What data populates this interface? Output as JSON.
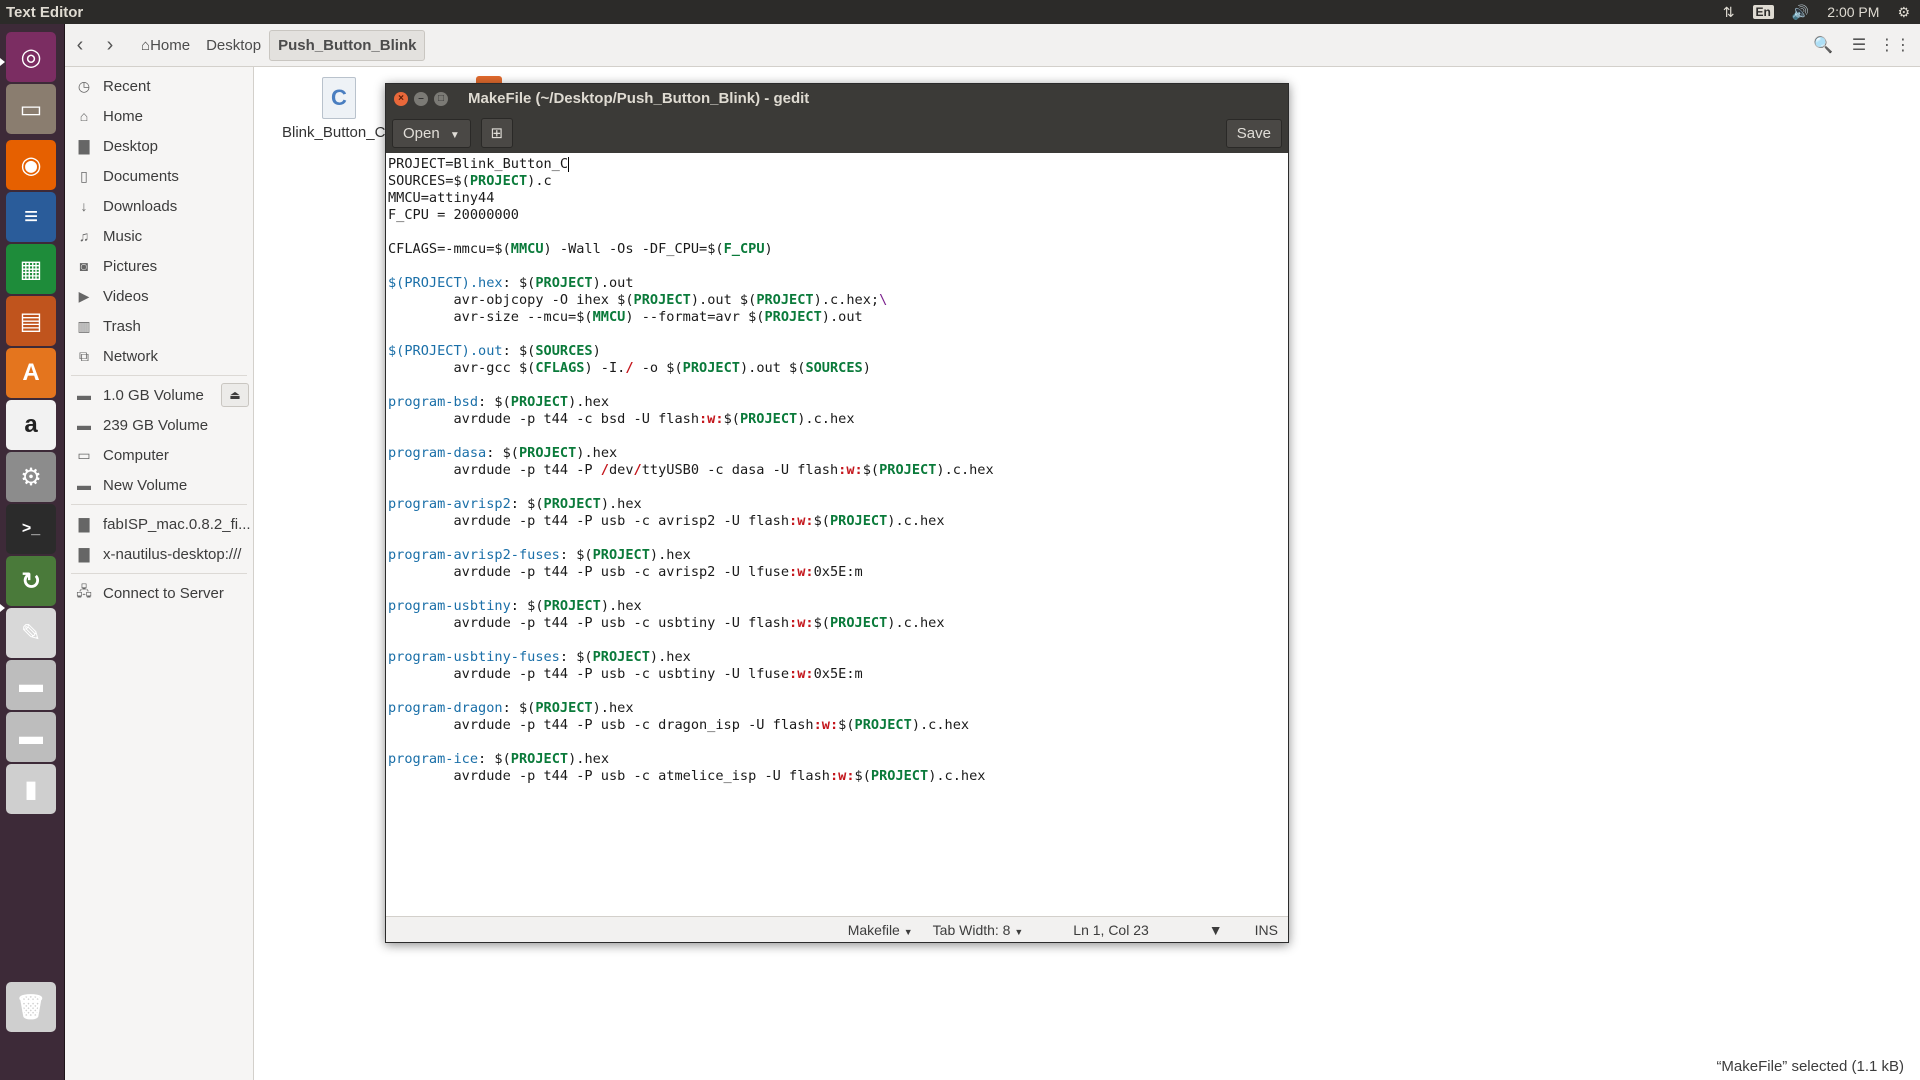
{
  "topbar": {
    "app_title": "Text Editor",
    "language": "En",
    "time": "2:00 PM"
  },
  "launcher": {
    "items": [
      {
        "icon": "ubuntu-dash-icon",
        "color": "#7b2d62"
      },
      {
        "icon": "files-icon",
        "color": "#8a7d6f"
      },
      {
        "icon": "firefox-icon",
        "color": "#e66000"
      },
      {
        "icon": "writer-icon",
        "color": "#2a5c9a"
      },
      {
        "icon": "calc-icon",
        "color": "#1e8c3a"
      },
      {
        "icon": "impress-icon",
        "color": "#c0541d"
      },
      {
        "icon": "software-center-icon",
        "color": "#e4751e"
      },
      {
        "icon": "amazon-icon",
        "color": "#f2f2f2"
      },
      {
        "icon": "system-settings-icon",
        "color": "#8c8c8c"
      },
      {
        "icon": "terminal-icon",
        "color": "#2b2b2b"
      },
      {
        "icon": "software-updater-icon",
        "color": "#4a7a3a"
      },
      {
        "icon": "gedit-icon",
        "color": "#d8d8d8"
      },
      {
        "icon": "drive-icon",
        "color": "#bdbdbd"
      },
      {
        "icon": "drive-2-icon",
        "color": "#bdbdbd"
      },
      {
        "icon": "usb-drive-icon",
        "color": "#cfcfcf"
      },
      {
        "icon": "trash-icon",
        "color": "#cfcfcf"
      }
    ]
  },
  "nautilus": {
    "breadcrumbs": [
      "Home",
      "Desktop",
      "Push_Button_Blink"
    ],
    "sidebar": {
      "places": [
        {
          "label": "Recent",
          "icon": "clock-icon"
        },
        {
          "label": "Home",
          "icon": "home-icon"
        },
        {
          "label": "Desktop",
          "icon": "folder-icon"
        },
        {
          "label": "Documents",
          "icon": "document-icon"
        },
        {
          "label": "Downloads",
          "icon": "download-icon"
        },
        {
          "label": "Music",
          "icon": "music-icon"
        },
        {
          "label": "Pictures",
          "icon": "camera-icon"
        },
        {
          "label": "Videos",
          "icon": "video-icon"
        },
        {
          "label": "Trash",
          "icon": "trash-icon"
        },
        {
          "label": "Network",
          "icon": "network-icon"
        }
      ],
      "devices": [
        {
          "label": "1.0 GB Volume",
          "icon": "drive-icon"
        },
        {
          "label": "239 GB Volume",
          "icon": "drive-icon"
        },
        {
          "label": "Computer",
          "icon": "computer-icon"
        },
        {
          "label": "New Volume",
          "icon": "drive-icon"
        }
      ],
      "bookmarks": [
        {
          "label": "fabISP_mac.0.8.2_fi...",
          "icon": "folder-icon"
        },
        {
          "label": "x-nautilus-desktop:///",
          "icon": "folder-icon"
        }
      ],
      "connect_label": "Connect to Server"
    },
    "files": [
      {
        "label": "Blink_Button_C"
      }
    ],
    "status": "“MakeFile” selected  (1.1 kB)"
  },
  "gedit": {
    "title": "MakeFile (~/Desktop/Push_Button_Blink) - gedit",
    "open_label": "Open",
    "save_label": "Save",
    "code_lines": [
      [
        [
          "t",
          "PROJECT=Blink_Button_C"
        ]
      ],
      [
        [
          "t",
          "SOURCES=$("
        ],
        [
          "k",
          "PROJECT"
        ],
        [
          "t",
          ").c"
        ]
      ],
      [
        [
          "t",
          "MMCU=attiny44"
        ]
      ],
      [
        [
          "t",
          "F_CPU = 20000000"
        ]
      ],
      [
        [
          "t",
          ""
        ]
      ],
      [
        [
          "t",
          "CFLAGS=-mmcu=$("
        ],
        [
          "k",
          "MMCU"
        ],
        [
          "t",
          ") -Wall -Os -DF_CPU=$("
        ],
        [
          "k",
          "F_CPU"
        ],
        [
          "t",
          ")"
        ]
      ],
      [
        [
          "t",
          ""
        ]
      ],
      [
        [
          "v",
          "$(PROJECT).hex"
        ],
        [
          "t",
          ": $("
        ],
        [
          "k",
          "PROJECT"
        ],
        [
          "t",
          ").out"
        ]
      ],
      [
        [
          "t",
          "        avr-objcopy -O ihex $("
        ],
        [
          "k",
          "PROJECT"
        ],
        [
          "t",
          ").out $("
        ],
        [
          "k",
          "PROJECT"
        ],
        [
          "t",
          ").c.hex;"
        ],
        [
          "p",
          "\\"
        ]
      ],
      [
        [
          "t",
          "        avr-size --mcu=$("
        ],
        [
          "k",
          "MMCU"
        ],
        [
          "t",
          ") --format=avr $("
        ],
        [
          "k",
          "PROJECT"
        ],
        [
          "t",
          ").out"
        ]
      ],
      [
        [
          "t",
          ""
        ]
      ],
      [
        [
          "v",
          "$(PROJECT).out"
        ],
        [
          "t",
          ": $("
        ],
        [
          "k",
          "SOURCES"
        ],
        [
          "t",
          ")"
        ]
      ],
      [
        [
          "t",
          "        avr-gcc $("
        ],
        [
          "k",
          "CFLAGS"
        ],
        [
          "t",
          ") -I."
        ],
        [
          "r",
          "/"
        ],
        [
          "t",
          " -o $("
        ],
        [
          "k",
          "PROJECT"
        ],
        [
          "t",
          ").out $("
        ],
        [
          "k",
          "SOURCES"
        ],
        [
          "t",
          ")"
        ]
      ],
      [
        [
          "t",
          ""
        ]
      ],
      [
        [
          "v",
          "program-bsd"
        ],
        [
          "t",
          ": $("
        ],
        [
          "k",
          "PROJECT"
        ],
        [
          "t",
          ").hex"
        ]
      ],
      [
        [
          "t",
          "        avrdude -p t44 -c bsd -U flash"
        ],
        [
          "r",
          ":w:"
        ],
        [
          "t",
          "$("
        ],
        [
          "k",
          "PROJECT"
        ],
        [
          "t",
          ").c.hex"
        ]
      ],
      [
        [
          "t",
          ""
        ]
      ],
      [
        [
          "v",
          "program-dasa"
        ],
        [
          "t",
          ": $("
        ],
        [
          "k",
          "PROJECT"
        ],
        [
          "t",
          ").hex"
        ]
      ],
      [
        [
          "t",
          "        avrdude -p t44 -P "
        ],
        [
          "r",
          "/"
        ],
        [
          "t",
          "dev"
        ],
        [
          "r",
          "/"
        ],
        [
          "t",
          "ttyUSB0 -c dasa -U flash"
        ],
        [
          "r",
          ":w:"
        ],
        [
          "t",
          "$("
        ],
        [
          "k",
          "PROJECT"
        ],
        [
          "t",
          ").c.hex"
        ]
      ],
      [
        [
          "t",
          ""
        ]
      ],
      [
        [
          "v",
          "program-avrisp2"
        ],
        [
          "t",
          ": $("
        ],
        [
          "k",
          "PROJECT"
        ],
        [
          "t",
          ").hex"
        ]
      ],
      [
        [
          "t",
          "        avrdude -p t44 -P usb -c avrisp2 -U flash"
        ],
        [
          "r",
          ":w:"
        ],
        [
          "t",
          "$("
        ],
        [
          "k",
          "PROJECT"
        ],
        [
          "t",
          ").c.hex"
        ]
      ],
      [
        [
          "t",
          ""
        ]
      ],
      [
        [
          "v",
          "program-avrisp2-fuses"
        ],
        [
          "t",
          ": $("
        ],
        [
          "k",
          "PROJECT"
        ],
        [
          "t",
          ").hex"
        ]
      ],
      [
        [
          "t",
          "        avrdude -p t44 -P usb -c avrisp2 -U lfuse"
        ],
        [
          "r",
          ":w:"
        ],
        [
          "t",
          "0x5E:m"
        ]
      ],
      [
        [
          "t",
          ""
        ]
      ],
      [
        [
          "v",
          "program-usbtiny"
        ],
        [
          "t",
          ": $("
        ],
        [
          "k",
          "PROJECT"
        ],
        [
          "t",
          ").hex"
        ]
      ],
      [
        [
          "t",
          "        avrdude -p t44 -P usb -c usbtiny -U flash"
        ],
        [
          "r",
          ":w:"
        ],
        [
          "t",
          "$("
        ],
        [
          "k",
          "PROJECT"
        ],
        [
          "t",
          ").c.hex"
        ]
      ],
      [
        [
          "t",
          ""
        ]
      ],
      [
        [
          "v",
          "program-usbtiny-fuses"
        ],
        [
          "t",
          ": $("
        ],
        [
          "k",
          "PROJECT"
        ],
        [
          "t",
          ").hex"
        ]
      ],
      [
        [
          "t",
          "        avrdude -p t44 -P usb -c usbtiny -U lfuse"
        ],
        [
          "r",
          ":w:"
        ],
        [
          "t",
          "0x5E:m"
        ]
      ],
      [
        [
          "t",
          ""
        ]
      ],
      [
        [
          "v",
          "program-dragon"
        ],
        [
          "t",
          ": $("
        ],
        [
          "k",
          "PROJECT"
        ],
        [
          "t",
          ").hex"
        ]
      ],
      [
        [
          "t",
          "        avrdude -p t44 -P usb -c dragon_isp -U flash"
        ],
        [
          "r",
          ":w:"
        ],
        [
          "t",
          "$("
        ],
        [
          "k",
          "PROJECT"
        ],
        [
          "t",
          ").c.hex"
        ]
      ],
      [
        [
          "t",
          ""
        ]
      ],
      [
        [
          "v",
          "program-ice"
        ],
        [
          "t",
          ": $("
        ],
        [
          "k",
          "PROJECT"
        ],
        [
          "t",
          ").hex"
        ]
      ],
      [
        [
          "t",
          "        avrdude -p t44 -P usb -c atmelice_isp -U flash"
        ],
        [
          "r",
          ":w:"
        ],
        [
          "t",
          "$("
        ],
        [
          "k",
          "PROJECT"
        ],
        [
          "t",
          ").c.hex"
        ]
      ]
    ],
    "status": {
      "language": "Makefile",
      "tab_width": "Tab Width: 8",
      "position": "Ln 1, Col 23",
      "mode": "INS"
    }
  }
}
